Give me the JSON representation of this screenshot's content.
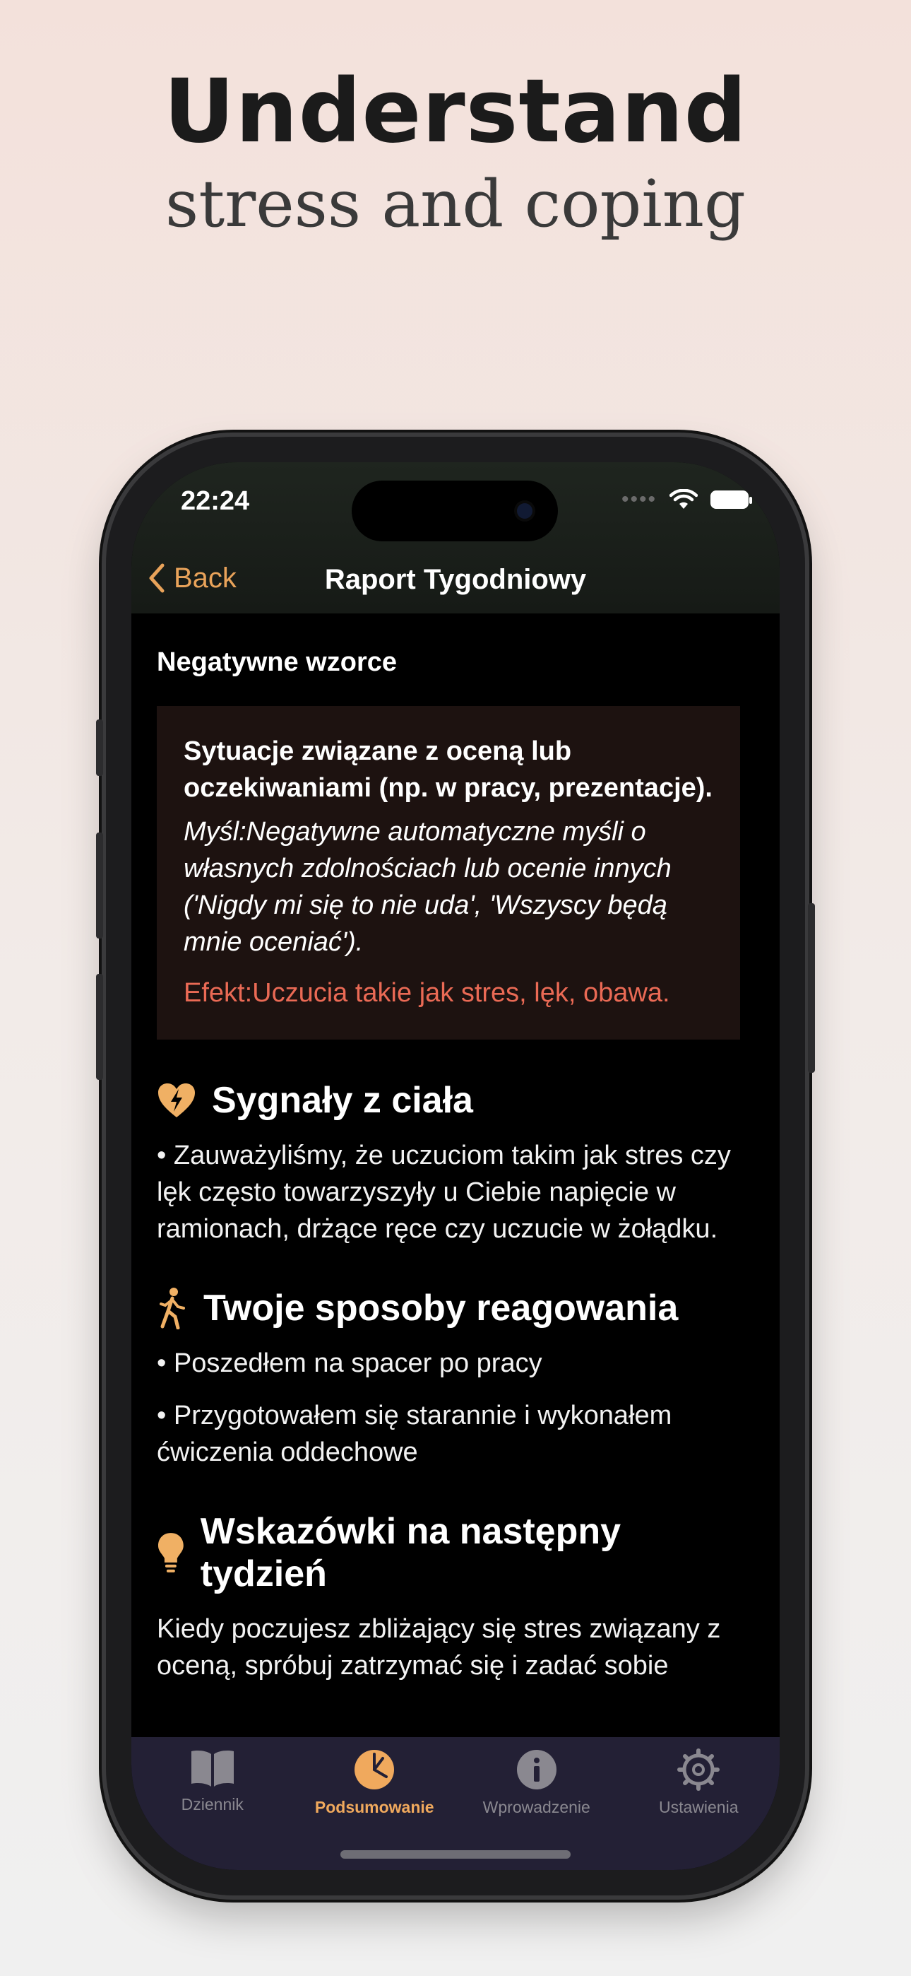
{
  "hero": {
    "title": "Understand",
    "subtitle": "stress and coping"
  },
  "status_bar": {
    "time": "22:24",
    "dots": "••••"
  },
  "nav": {
    "back_label": "Back",
    "title": "Raport Tygodniowy"
  },
  "negative_patterns": {
    "label": "Negatywne wzorce",
    "card": {
      "situation": "Sytuacje związane z oceną lub oczekiwaniami (np. w pracy, prezentacje).",
      "thought": "Myśl:Negatywne automatyczne myśli o własnych zdolnościach lub ocenie innych ('Nigdy mi się to nie uda', 'Wszyscy będą mnie oceniać').",
      "effect": "Efekt:Uczucia takie jak stres, lęk, obawa."
    }
  },
  "body_signals": {
    "heading": "Sygnały z ciała",
    "text": "• Zauważyliśmy, że uczuciom takim jak stres czy lęk często towarzyszyły u Ciebie napięcie w ramionach, drżące ręce czy uczucie w żołądku."
  },
  "coping": {
    "heading": "Twoje sposoby reagowania",
    "items": [
      "• Poszedłem na spacer po pracy",
      "• Przygotowałem się starannie i wykonałem ćwiczenia oddechowe"
    ]
  },
  "tips": {
    "heading": "Wskazówki na następny tydzień",
    "text": "Kiedy poczujesz zbliżający się stres związany z oceną, spróbuj zatrzymać się i zadać sobie"
  },
  "tabs": [
    {
      "label": "Dziennik",
      "icon": "book-icon",
      "active": false
    },
    {
      "label": "Podsumowanie",
      "icon": "pie-chart-icon",
      "active": true
    },
    {
      "label": "Wprowadzenie",
      "icon": "info-icon",
      "active": false
    },
    {
      "label": "Ustawienia",
      "icon": "gear-icon",
      "active": false
    }
  ],
  "colors": {
    "accent": "#f0a95d",
    "effect": "#ea6a55",
    "card_bg": "#1d1210",
    "tabbar_bg": "#232035"
  }
}
